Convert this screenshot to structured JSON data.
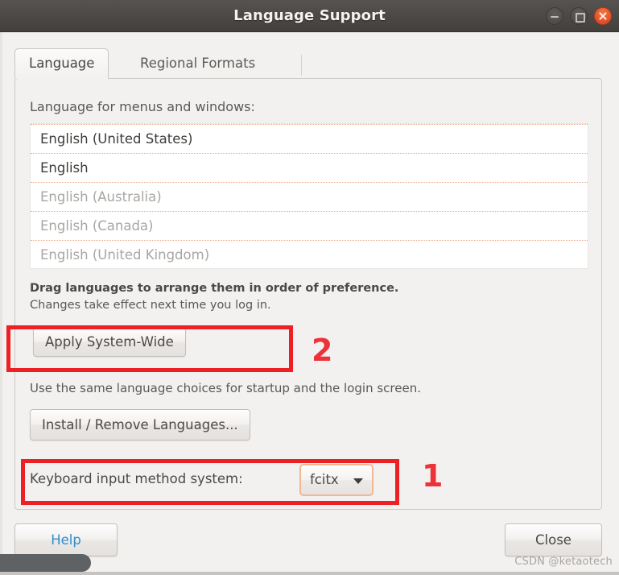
{
  "window": {
    "title": "Language Support",
    "controls": {
      "minimize": "minimize-icon",
      "maximize": "maximize-icon",
      "close": "close-icon"
    }
  },
  "tabs": [
    {
      "label": "Language",
      "active": true
    },
    {
      "label": "Regional Formats",
      "active": false
    }
  ],
  "language_panel": {
    "list_label": "Language for menus and windows:",
    "languages": [
      {
        "name": "English (United States)",
        "state": "strong"
      },
      {
        "name": "English",
        "state": "strong"
      },
      {
        "name": "English (Australia)",
        "state": "dim"
      },
      {
        "name": "English (Canada)",
        "state": "dim"
      },
      {
        "name": "English (United Kingdom)",
        "state": "dim"
      }
    ],
    "drag_hint": "Drag languages to arrange them in order of preference.",
    "changes_hint": "Changes take effect next time you log in.",
    "apply_button": "Apply System-Wide",
    "apply_hint": "Use the same language choices for startup and the login screen.",
    "install_button": "Install / Remove Languages...",
    "ime_label": "Keyboard input method system:",
    "ime_value": "fcitx",
    "ime_options": [
      "fcitx"
    ]
  },
  "actions": {
    "help": "Help",
    "close": "Close"
  },
  "annotations": [
    {
      "number": "2",
      "target": "apply-system-wide-button",
      "color": "#ed2024"
    },
    {
      "number": "1",
      "target": "keyboard-input-method-row",
      "color": "#ed2024"
    }
  ],
  "watermark": "CSDN @ketaotech",
  "colors": {
    "titlebar": "#4b4845",
    "window_bg": "#f2f1f0",
    "accent_red": "#ed2024",
    "close_button": "#e1512a",
    "link_blue": "#2f8ecb",
    "list_separator": "#f0a882",
    "focus_border": "#f0b894"
  }
}
